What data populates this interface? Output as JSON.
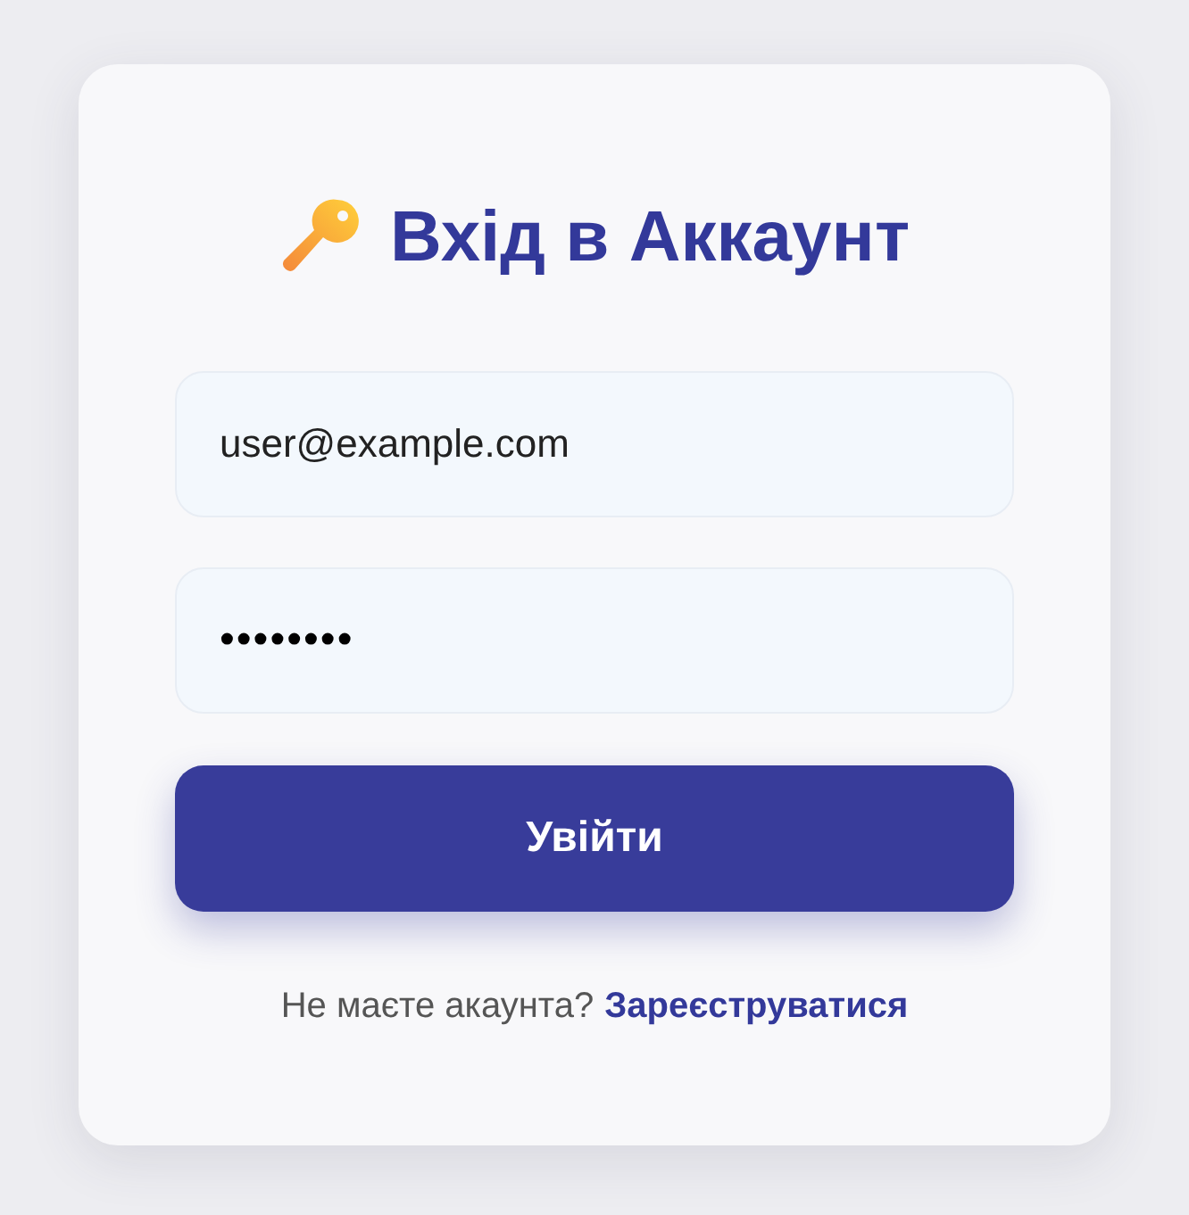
{
  "card": {
    "title": "Вхід в Аккаунт",
    "fields": [
      {
        "kind": "email",
        "value": "user@example.com"
      },
      {
        "kind": "password",
        "value": "••••••••"
      }
    ],
    "submit": "Увійти",
    "footer": {
      "text": "Не маєте акаунта?",
      "link": "Зареєструватися"
    }
  }
}
